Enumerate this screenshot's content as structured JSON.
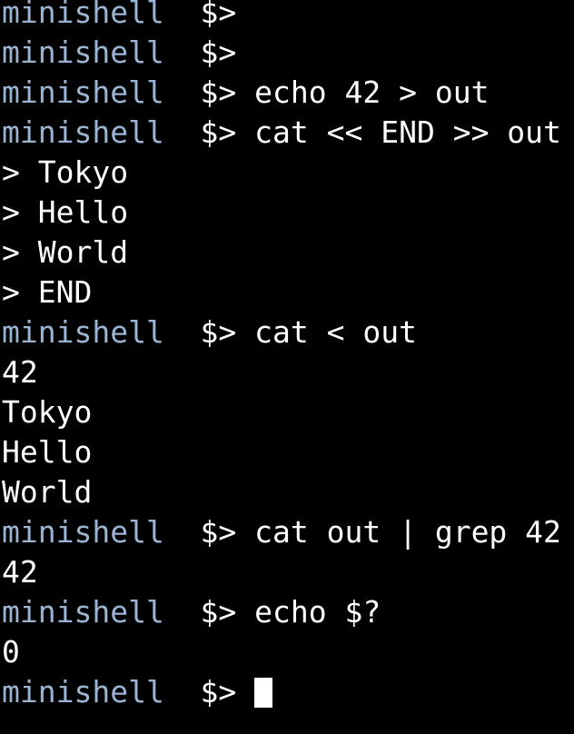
{
  "terminal": {
    "title": "minishell",
    "background_color": "#000000",
    "prompt_color": "#9ab5d4",
    "text_color": "#ffffff",
    "cursor_color": "#ffffff",
    "prompt_host": "minishell",
    "prompt_symbol": "  $> ",
    "heredoc_symbol": "> ",
    "cursor_glyph": "█"
  },
  "lines": [
    {
      "kind": "prompt",
      "host": "minishell",
      "symbol": "  $> ",
      "command": ""
    },
    {
      "kind": "prompt",
      "host": "minishell",
      "symbol": "  $> ",
      "command": ""
    },
    {
      "kind": "prompt",
      "host": "minishell",
      "symbol": "  $> ",
      "command": "echo 42 > out"
    },
    {
      "kind": "prompt",
      "host": "minishell",
      "symbol": "  $> ",
      "command": "cat << END >> out"
    },
    {
      "kind": "heredoc",
      "symbol": "> ",
      "text": "Tokyo"
    },
    {
      "kind": "heredoc",
      "symbol": "> ",
      "text": "Hello"
    },
    {
      "kind": "heredoc",
      "symbol": "> ",
      "text": "World"
    },
    {
      "kind": "heredoc",
      "symbol": "> ",
      "text": "END"
    },
    {
      "kind": "prompt",
      "host": "minishell",
      "symbol": "  $> ",
      "command": "cat < out"
    },
    {
      "kind": "output",
      "text": "42"
    },
    {
      "kind": "output",
      "text": "Tokyo"
    },
    {
      "kind": "output",
      "text": "Hello"
    },
    {
      "kind": "output",
      "text": "World"
    },
    {
      "kind": "prompt",
      "host": "minishell",
      "symbol": "  $> ",
      "command": "cat out | grep 42"
    },
    {
      "kind": "output",
      "text": "42"
    },
    {
      "kind": "prompt",
      "host": "minishell",
      "symbol": "  $> ",
      "command": "echo $?"
    },
    {
      "kind": "output",
      "text": "0"
    },
    {
      "kind": "prompt",
      "host": "minishell",
      "symbol": "  $> ",
      "command": "",
      "cursor": true
    }
  ]
}
